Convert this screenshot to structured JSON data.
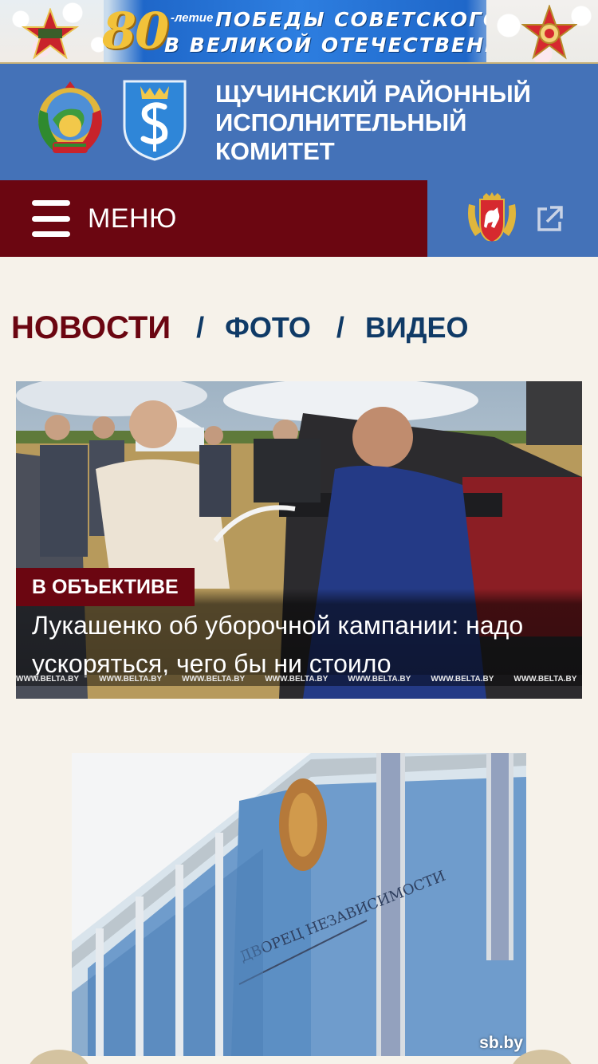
{
  "banner": {
    "big_number": "80",
    "suffix": "-летие",
    "line1": "ПОБЕДЫ СОВЕТСКОГО НАРОДА",
    "line2": "В ВЕЛИКОЙ ОТЕЧЕСТВЕННОЙ ВОЙНЕ"
  },
  "header": {
    "title_lines": [
      "ЩУЧИНСКИЙ РАЙОННЫЙ",
      "ИСПОЛНИТЕЛЬНЫЙ",
      "КОМИТЕТ"
    ]
  },
  "menu": {
    "label": "МЕНЮ"
  },
  "tabs": [
    {
      "label": "НОВОСТИ",
      "active": true
    },
    {
      "label": "ФОТО",
      "active": false
    },
    {
      "label": "ВИДЕО",
      "active": false
    }
  ],
  "tab_separator": "/",
  "news": [
    {
      "category": "В ОБЪЕКТИВЕ",
      "title": "Лукашенко об уборочной кампании: надо ускоряться, чего бы ни стоило",
      "watermark": "WWW.BELTA.BY"
    },
    {
      "image_text": "ДВОРЕЦ НЕЗАВИСИМОСТИ",
      "credit": "sb.by"
    }
  ],
  "colors": {
    "header_blue": "#4472b8",
    "menu_maroon": "#6b0611",
    "tab_navy": "#0f3a66",
    "page_bg": "#f6f2ea"
  }
}
